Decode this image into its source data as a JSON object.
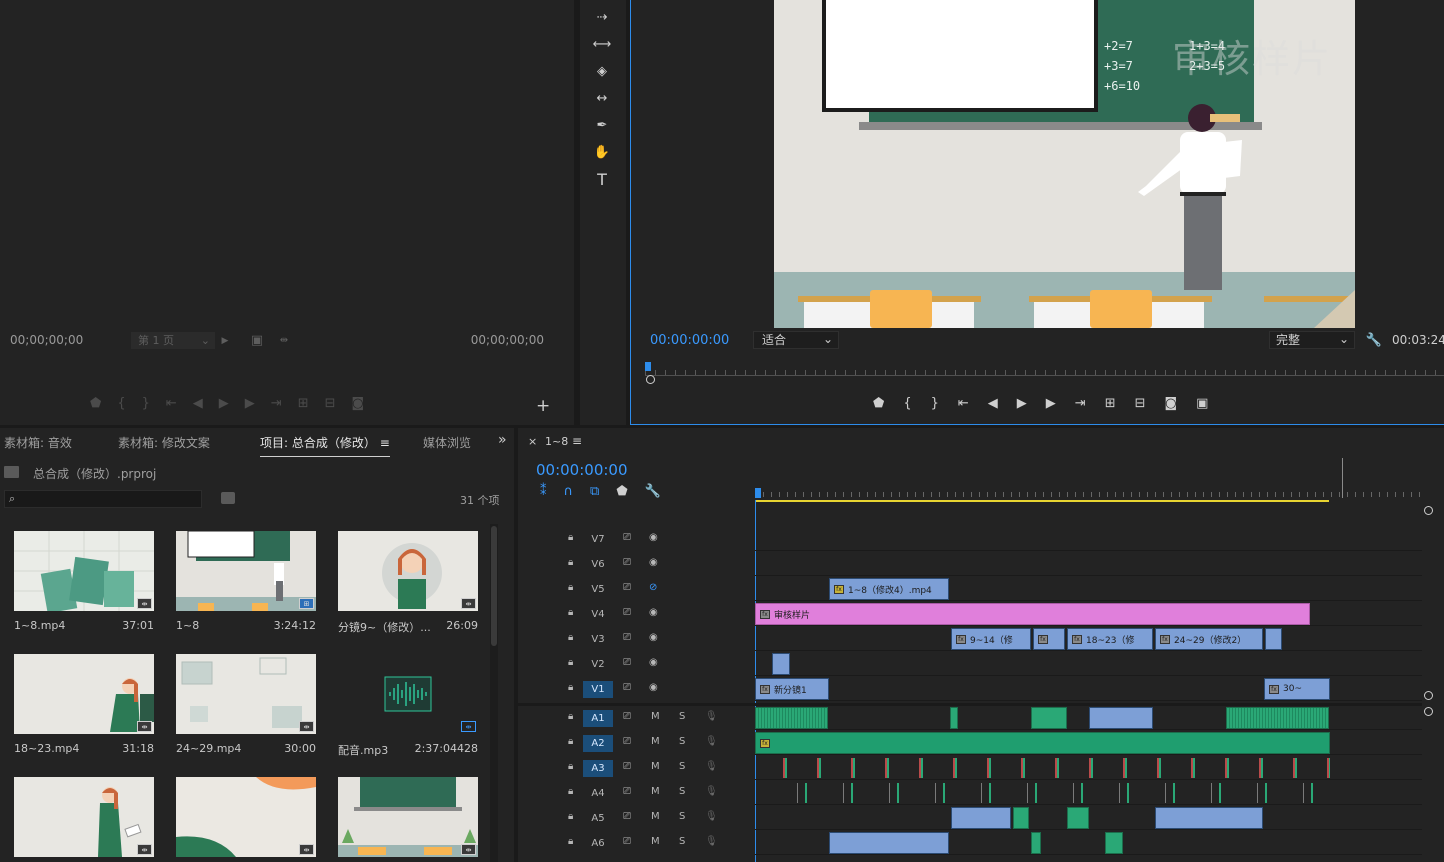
{
  "source_monitor": {
    "timecode_left": "00;00;00;00",
    "page_select": "第 1 页",
    "timecode_right": "00;00;00;00"
  },
  "program_monitor": {
    "timecode": "00:00:00:00",
    "fit_select": "适合",
    "quality_select": "完整",
    "duration": "00:03:24",
    "watermark": "审核样片",
    "board_math": [
      "+2=7",
      "+3=7",
      "+6=10",
      "1+3=4",
      "2+3=5"
    ]
  },
  "project_panel": {
    "tabs": [
      "素材箱: 音效",
      "素材箱: 修改文案",
      "项目: 总合成（修改）",
      "媒体浏览"
    ],
    "active_tab_index": 2,
    "project_file": "总合成（修改）.prproj",
    "search_placeholder": "",
    "item_count": "31 个项",
    "items": [
      {
        "name": "1~8.mp4",
        "duration": "37:01",
        "kind": "video"
      },
      {
        "name": "1~8",
        "duration": "3:24:12",
        "kind": "sequence"
      },
      {
        "name": "分镜9~（修改）...",
        "duration": "26:09",
        "kind": "video"
      },
      {
        "name": "18~23.mp4",
        "duration": "31:18",
        "kind": "video"
      },
      {
        "name": "24~29.mp4",
        "duration": "30:00",
        "kind": "video"
      },
      {
        "name": "配音.mp3",
        "duration": "2:37:04428",
        "kind": "audio"
      },
      {
        "name": "",
        "duration": "",
        "kind": "video"
      },
      {
        "name": "",
        "duration": "",
        "kind": "video"
      },
      {
        "name": "",
        "duration": "",
        "kind": "video"
      }
    ]
  },
  "timeline": {
    "sequence_name": "1~8",
    "timecode": "00:00:00:00",
    "video_tracks": [
      "V7",
      "V6",
      "V5",
      "V4",
      "V3",
      "V2",
      "V1"
    ],
    "audio_tracks": [
      "A1",
      "A2",
      "A3",
      "A4",
      "A5",
      "A6"
    ],
    "track_buttons": {
      "mute": "M",
      "solo": "S"
    },
    "clips": {
      "v5": "1~8（修改4）.mp4",
      "v4": "审核样片",
      "v3_a": "9~14（修",
      "v3_b": "18~23（修",
      "v3_c": "24~29（修改2）",
      "v1_a": "新分镜1",
      "v1_b": "30~"
    }
  },
  "colors": {
    "accent": "#2d8ceb",
    "video_clip": "#7d9fd6",
    "adjustment_clip": "#e07fdb",
    "audio_clip": "#2aa876",
    "track_active": "#1b4e7a"
  }
}
